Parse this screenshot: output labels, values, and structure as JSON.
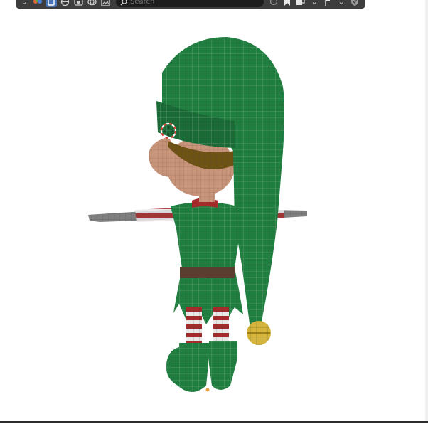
{
  "header": {
    "search_placeholder": "Search",
    "icons": [
      "chevron-down-icon",
      "color-palette-icon",
      "clipboard-icon",
      "globe-icon",
      "render-icon",
      "overlay-icon",
      "image-icon",
      "search-icon",
      "circle-icon",
      "bookmark-icon",
      "collection-icon",
      "chevron-down-icon",
      "flag-icon",
      "chevron-down-icon",
      "shield-icon"
    ]
  },
  "colors": {
    "header_bg": "#3d3d3d",
    "active_blue": "#4772b3",
    "hat_green": "#1f7d3f",
    "skin": "#c8957b",
    "bell_gold": "#d4b43a",
    "wire": "#9aa59d"
  }
}
